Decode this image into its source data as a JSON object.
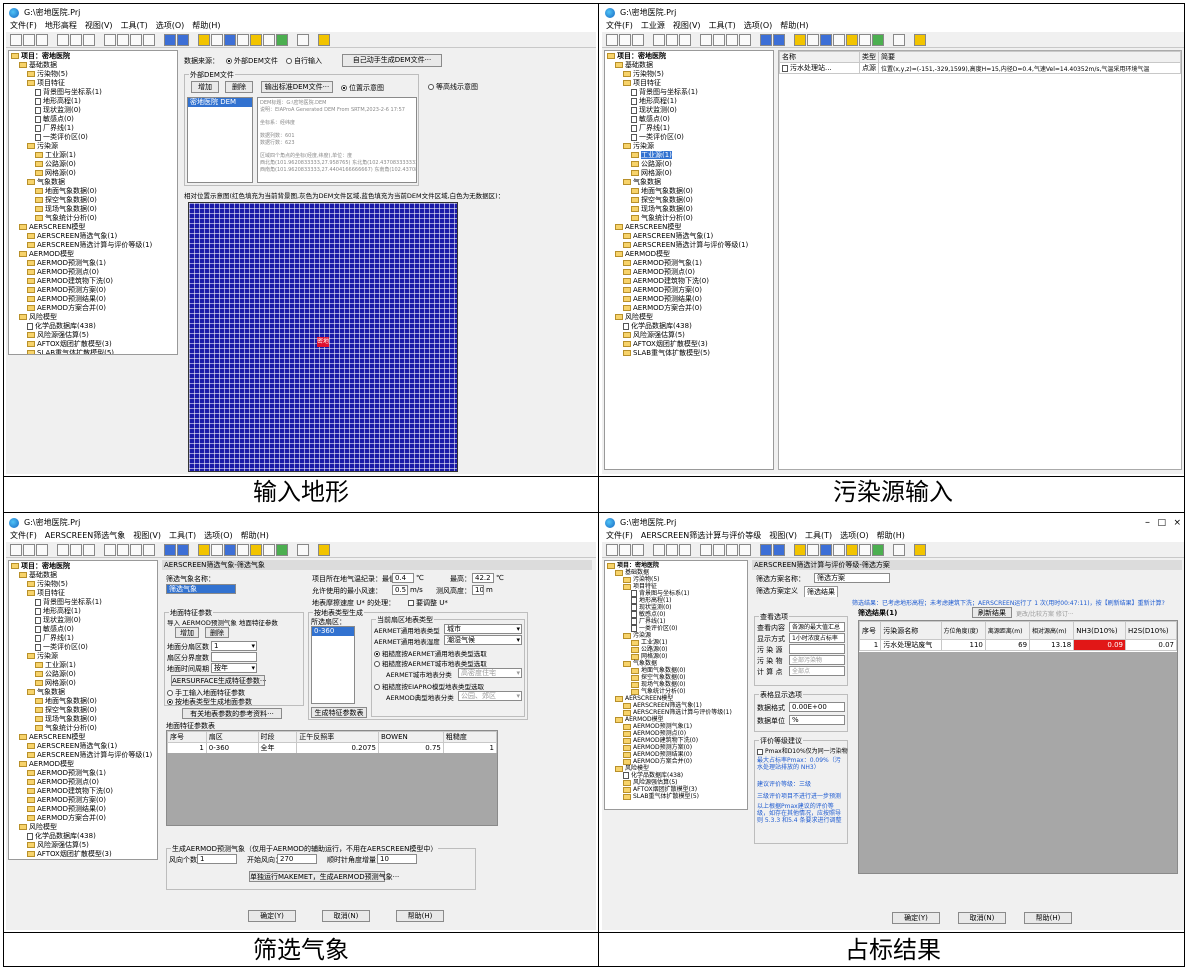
{
  "window": {
    "title": "G:\\密地医院.Prj"
  },
  "menus": {
    "q1": [
      "文件(F)",
      "地形高程",
      "视图(V)",
      "工具(T)",
      "选项(O)",
      "帮助(H)"
    ],
    "q2": [
      "文件(F)",
      "工业源",
      "视图(V)",
      "工具(T)",
      "选项(O)",
      "帮助(H)"
    ],
    "q3": [
      "文件(F)",
      "AERSCREEN筛选气象",
      "视图(V)",
      "工具(T)",
      "选项(O)",
      "帮助(H)"
    ],
    "q4": [
      "文件(F)",
      "AERSCREEN筛选计算与评价等级",
      "视图(V)",
      "工具(T)",
      "选项(O)",
      "帮助(H)"
    ]
  },
  "tree": [
    {
      "level": 0,
      "type": "folder",
      "label": "项目：密地医院",
      "bold": true
    },
    {
      "level": 1,
      "type": "folder",
      "label": "基础数据"
    },
    {
      "level": 2,
      "type": "folder",
      "label": "污染物(5)"
    },
    {
      "level": 2,
      "type": "folder",
      "label": "项目特征"
    },
    {
      "level": 3,
      "type": "doc",
      "label": "背景图与坐标系(1)"
    },
    {
      "level": 3,
      "type": "doc",
      "label": "地形高程(1)"
    },
    {
      "level": 3,
      "type": "doc",
      "label": "现状监测(0)"
    },
    {
      "level": 3,
      "type": "doc",
      "label": "敏感点(0)"
    },
    {
      "level": 3,
      "type": "doc",
      "label": "厂界线(1)"
    },
    {
      "level": 3,
      "type": "doc",
      "label": "一类评价区(0)"
    },
    {
      "level": 2,
      "type": "folder",
      "label": "污染源"
    },
    {
      "level": 3,
      "type": "folder",
      "label": "工业源(1)"
    },
    {
      "level": 3,
      "type": "folder",
      "label": "公路源(0)"
    },
    {
      "level": 3,
      "type": "folder",
      "label": "网格源(0)"
    },
    {
      "level": 2,
      "type": "folder",
      "label": "气象数据"
    },
    {
      "level": 3,
      "type": "folder",
      "label": "地面气象数据(0)"
    },
    {
      "level": 3,
      "type": "folder",
      "label": "探空气象数据(0)"
    },
    {
      "level": 3,
      "type": "folder",
      "label": "现场气象数据(0)"
    },
    {
      "level": 3,
      "type": "folder",
      "label": "气象统计分析(0)"
    },
    {
      "level": 1,
      "type": "folder",
      "label": "AERSCREEN模型"
    },
    {
      "level": 2,
      "type": "folder",
      "label": "AERSCREEN筛选气象(1)"
    },
    {
      "level": 2,
      "type": "folder",
      "label": "AERSCREEN筛选计算与评价等级(1)"
    },
    {
      "level": 1,
      "type": "folder",
      "label": "AERMOD模型"
    },
    {
      "level": 2,
      "type": "folder",
      "label": "AERMOD预测气象(1)"
    },
    {
      "level": 2,
      "type": "folder",
      "label": "AERMOD预测点(0)"
    },
    {
      "level": 2,
      "type": "folder",
      "label": "AERMOD建筑物下洗(0)"
    },
    {
      "level": 2,
      "type": "folder",
      "label": "AERMOD预测方案(0)"
    },
    {
      "level": 2,
      "type": "folder",
      "label": "AERMOD预测结果(0)"
    },
    {
      "level": 2,
      "type": "folder",
      "label": "AERMOD方案合并(0)"
    },
    {
      "level": 1,
      "type": "folder",
      "label": "风险模型"
    },
    {
      "level": 2,
      "type": "doc",
      "label": "化学品数据库(438)"
    },
    {
      "level": 2,
      "type": "folder",
      "label": "风险源强估算(5)"
    },
    {
      "level": 2,
      "type": "folder",
      "label": "AFTOX烟团扩散模型(3)"
    },
    {
      "level": 2,
      "type": "folder",
      "label": "SLAB重气体扩散模型(5)"
    }
  ],
  "q1": {
    "caption": "输入地形",
    "data_source_label": "数据来源：",
    "radio_external": "外部DEM文件",
    "radio_custom": "自行输入",
    "btn_manual": "自己动手生成DEM文件···",
    "group_title": "外部DEM文件",
    "btn_add": "增加",
    "btn_delete": "删除",
    "btn_export": "输出标准DEM文件···",
    "radio_position": "位置示意图",
    "radio_contour": "等高线示意图",
    "dem_item": "密地医院 DEM",
    "info_lines": [
      "DEM标题：G:\\密地医院.DEM",
      "说明：EIAProA Generated DEM From SRTM,2023-2-6 17:57",
      "",
      "坐标系：经纬度",
      "",
      "数据列数：601",
      "数据行数：623",
      "",
      "区域四个角点的坐标(经度,纬度),单位：度",
      "    西北角(101.9620833333,27.958765)    东北角(102.437083333333,27.958765)",
      "    西南角(101.9620833333,27.4404166666667)    东南角(102.437083333333,27.4404166666667)"
    ],
    "map_caption": "相对位置示意图(红色填充为当前背景图,灰色为DEM文件区域,蓝色填充为当前DEM文件区域,白色为无数据区)：",
    "marker": "密地"
  },
  "q2": {
    "caption": "污染源输入",
    "col_name": "名称",
    "col_type": "类型",
    "col_desc": "简要",
    "row": {
      "name": "污水处理站...",
      "type": "点源",
      "desc": "位置(x,y,z)=(-151,-329,1599),高度H=15,内径D=0.4,气速Vel=14.40352m/s,气温采用环境气温"
    }
  },
  "q3": {
    "caption": "筛选气象",
    "panel_title": "AERSCREEN筛选气象-筛选气象",
    "name_label": "筛选气象名称：",
    "name_value": "筛选气象",
    "temp_label": "项目所在地气温纪录：最低",
    "temp_min": "0.4",
    "temp_unit": "℃",
    "temp_max_label": "最高：",
    "temp_max": "42.2",
    "wind_label": "允许使用的最小风速：",
    "wind_value": "0.5",
    "wind_unit": "m/s",
    "anemo_label": "测风高度：",
    "anemo_value": "10",
    "anemo_unit": "m",
    "friction_label": "地表摩擦速度 U* 的处理：",
    "friction_chk": "要调整 U*",
    "surface_group": "地面特征参数",
    "import_text": "导入 AERMOD预测气象 地面特征参数",
    "btn_add": "增加",
    "btn_delete": "删除",
    "sector_count_label": "地面分扇区数",
    "sector_count_value": "1",
    "sector_split_label": "扇区分界度数",
    "time_period_label": "地面时间周期",
    "time_period_value": "按年",
    "btn_aersurface": "AERSURFACE生成特征参数···",
    "radio_manual": "手工输入地面特征参数",
    "radio_landuse": "按地表类型生成地面参数",
    "btn_ref": "有关地表参数的参考资料···",
    "landuse_group": "按地表类型生成",
    "sector_label": "所选扇区：",
    "sector_item": "0-360",
    "cur_landuse_group": "当前扇区地表类型",
    "aermet_type_label": "AERMET通用地表类型",
    "aermet_type_value": "城市",
    "aermet_wet_label": "AERMET通用地表湿度",
    "aermet_wet_value": "潮湿气候",
    "r1": "粗糙度按AERMET通用地表类型选取",
    "r2": "粗糙度按AERMET城市地表类型选取",
    "city_type_label": "AERMET城市地表分类",
    "city_type_value": "高密度住宅",
    "r3": "粗糙度按EIAPRO模型地表类型选取",
    "aermod_type_label": "AERMOD典型地表分类",
    "aermod_type_value": "公园、郊区",
    "btn_gen": "生成特征参数表",
    "table_title": "地面特征参数表",
    "table_headers": [
      "序号",
      "扇区",
      "时段",
      "正午反照率",
      "BOWEN",
      "粗糙度"
    ],
    "table_row": [
      "1",
      "0-360",
      "全年",
      "0.2075",
      "0.75",
      "1"
    ],
    "aermod_group": "生成AERMOD预测气象（仅用于AERMOD的辅助运行，不用在AERSCREEN模型中）",
    "wind_dir_label": "风向个数：",
    "wind_dir_value": "1",
    "start_dir_label": "开始风向：",
    "start_dir_value": "270",
    "cw_label": "顺时针角度增量：",
    "cw_value": "10",
    "btn_run": "单独运行MAKEMET，生成AERMOD预测气象···",
    "btn_ok": "确定(Y)",
    "btn_cancel": "取消(N)",
    "btn_help": "帮助(H)"
  },
  "q4": {
    "caption": "占标结果",
    "panel_title": "AERSCREEN筛选计算与评价等级-筛选方案",
    "scheme_label": "筛选方案名称：",
    "scheme_value": "筛选方案",
    "tab1": "筛选方案定义",
    "tab2": "筛选结果",
    "result_text": "筛选结果：已考虑地形高程；未考虑建筑下洗；AERSCREEN运行了 1 次(用时00:47:11)，按【刷新结果】重新计算?",
    "result_table_title": "筛选结果(1)",
    "btn_refresh": "刷新结果",
    "btn_more": "更改/比较方案 修订···",
    "view_group": "查看选项",
    "view_content_label": "查看内容",
    "view_content_value": "各源的最大值汇总",
    "display_label": "显示方式",
    "display_value": "1小时浓度占标率",
    "pollutant_label": "污 染 源",
    "pollutant_value": "",
    "pollutant2_label": "污 染 物",
    "pollutant2_value": "全部污染物",
    "compute_label": "计 算 点",
    "compute_value": "全部点",
    "table_disp_group": "表格显示选项",
    "data_fmt_label": "数据格式",
    "data_fmt_value": "0.00E+00",
    "unit_label": "数据单位",
    "unit_value": "%",
    "eval_group": "评价等级建议",
    "eval_chk": "Pmax和D10%仅为同一污染物",
    "eval_l1": "最大占标率Pmax：0.09%（污水处理站排放的 NH3）",
    "eval_l2": "建议评价等级：三级",
    "eval_l3": "三级评价项目不进行进一步预测",
    "eval_l4": "以上根据Pmax建议的评价等级，如存在其他情况，应按照导则 5.3.3 和5.4 条要求进行调整",
    "col_headers": [
      "序号",
      "污染源名称",
      "方位角度(度)",
      "离源距离(m)",
      "相对源高(m)",
      "NH3(D10%)",
      "H2S(D10%)"
    ],
    "row": [
      "1",
      "污水处理站废气",
      "110",
      "69",
      "13.18",
      "0.09",
      "0.07"
    ]
  },
  "colors": {
    "dem_blue": "#1a1aa8",
    "marker_red": "#e0102f",
    "selection": "#3272d0",
    "max_cell_red": "#e11717"
  }
}
